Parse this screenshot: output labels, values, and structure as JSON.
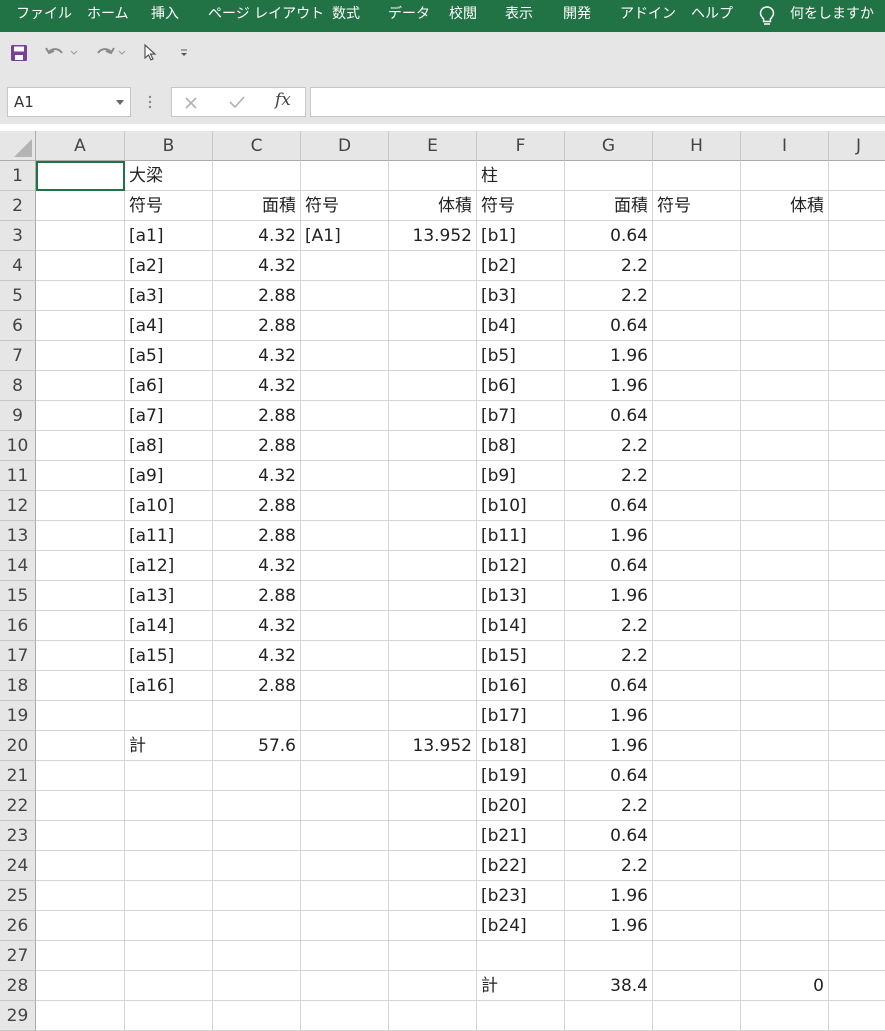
{
  "ribbon": {
    "tabs": [
      "ファイル",
      "ホーム",
      "挿入",
      "ページ レイアウト",
      "数式",
      "データ",
      "校閲",
      "表示",
      "開発",
      "アドイン",
      "ヘルプ"
    ],
    "search_label": "何をしますか",
    "accent": "#217346"
  },
  "quick_access": {
    "icons": [
      "save-icon",
      "undo-icon",
      "redo-icon",
      "select-cursor-icon",
      "customize-dropdown-icon"
    ]
  },
  "formula_bar": {
    "name_box": "A1",
    "fx_label": "fx",
    "content": ""
  },
  "sheet": {
    "columns": [
      "A",
      "B",
      "C",
      "D",
      "E",
      "F",
      "G",
      "H",
      "I",
      "J"
    ],
    "rows": [
      "1",
      "2",
      "3",
      "4",
      "5",
      "6",
      "7",
      "8",
      "9",
      "10",
      "11",
      "12",
      "13",
      "14",
      "15",
      "16",
      "17",
      "18",
      "19",
      "20",
      "21",
      "22",
      "23",
      "24",
      "25",
      "26",
      "27",
      "28",
      "29"
    ],
    "selected_cell": "A1",
    "cells": [
      [
        "",
        "大梁",
        "",
        "",
        "",
        "柱",
        "",
        "",
        "",
        ""
      ],
      [
        "",
        "符号",
        "面積",
        "符号",
        "体積",
        "符号",
        "面積",
        "符号",
        "体積",
        ""
      ],
      [
        "",
        "[a1]",
        "4.32",
        "[A1]",
        "13.952",
        "[b1]",
        "0.64",
        "",
        "",
        ""
      ],
      [
        "",
        "[a2]",
        "4.32",
        "",
        "",
        "[b2]",
        "2.2",
        "",
        "",
        ""
      ],
      [
        "",
        "[a3]",
        "2.88",
        "",
        "",
        "[b3]",
        "2.2",
        "",
        "",
        ""
      ],
      [
        "",
        "[a4]",
        "2.88",
        "",
        "",
        "[b4]",
        "0.64",
        "",
        "",
        ""
      ],
      [
        "",
        "[a5]",
        "4.32",
        "",
        "",
        "[b5]",
        "1.96",
        "",
        "",
        ""
      ],
      [
        "",
        "[a6]",
        "4.32",
        "",
        "",
        "[b6]",
        "1.96",
        "",
        "",
        ""
      ],
      [
        "",
        "[a7]",
        "2.88",
        "",
        "",
        "[b7]",
        "0.64",
        "",
        "",
        ""
      ],
      [
        "",
        "[a8]",
        "2.88",
        "",
        "",
        "[b8]",
        "2.2",
        "",
        "",
        ""
      ],
      [
        "",
        "[a9]",
        "4.32",
        "",
        "",
        "[b9]",
        "2.2",
        "",
        "",
        ""
      ],
      [
        "",
        "[a10]",
        "2.88",
        "",
        "",
        "[b10]",
        "0.64",
        "",
        "",
        ""
      ],
      [
        "",
        "[a11]",
        "2.88",
        "",
        "",
        "[b11]",
        "1.96",
        "",
        "",
        ""
      ],
      [
        "",
        "[a12]",
        "4.32",
        "",
        "",
        "[b12]",
        "0.64",
        "",
        "",
        ""
      ],
      [
        "",
        "[a13]",
        "2.88",
        "",
        "",
        "[b13]",
        "1.96",
        "",
        "",
        ""
      ],
      [
        "",
        "[a14]",
        "4.32",
        "",
        "",
        "[b14]",
        "2.2",
        "",
        "",
        ""
      ],
      [
        "",
        "[a15]",
        "4.32",
        "",
        "",
        "[b15]",
        "2.2",
        "",
        "",
        ""
      ],
      [
        "",
        "[a16]",
        "2.88",
        "",
        "",
        "[b16]",
        "0.64",
        "",
        "",
        ""
      ],
      [
        "",
        "",
        "",
        "",
        "",
        "[b17]",
        "1.96",
        "",
        "",
        ""
      ],
      [
        "",
        "計",
        "57.6",
        "",
        "13.952",
        "[b18]",
        "1.96",
        "",
        "",
        ""
      ],
      [
        "",
        "",
        "",
        "",
        "",
        "[b19]",
        "0.64",
        "",
        "",
        ""
      ],
      [
        "",
        "",
        "",
        "",
        "",
        "[b20]",
        "2.2",
        "",
        "",
        ""
      ],
      [
        "",
        "",
        "",
        "",
        "",
        "[b21]",
        "0.64",
        "",
        "",
        ""
      ],
      [
        "",
        "",
        "",
        "",
        "",
        "[b22]",
        "2.2",
        "",
        "",
        ""
      ],
      [
        "",
        "",
        "",
        "",
        "",
        "[b23]",
        "1.96",
        "",
        "",
        ""
      ],
      [
        "",
        "",
        "",
        "",
        "",
        "[b24]",
        "1.96",
        "",
        "",
        ""
      ],
      [
        "",
        "",
        "",
        "",
        "",
        "",
        "",
        "",
        "",
        ""
      ],
      [
        "",
        "",
        "",
        "",
        "",
        "計",
        "38.4",
        "",
        "0",
        ""
      ],
      [
        "",
        "",
        "",
        "",
        "",
        "",
        "",
        "",
        "",
        ""
      ]
    ]
  }
}
